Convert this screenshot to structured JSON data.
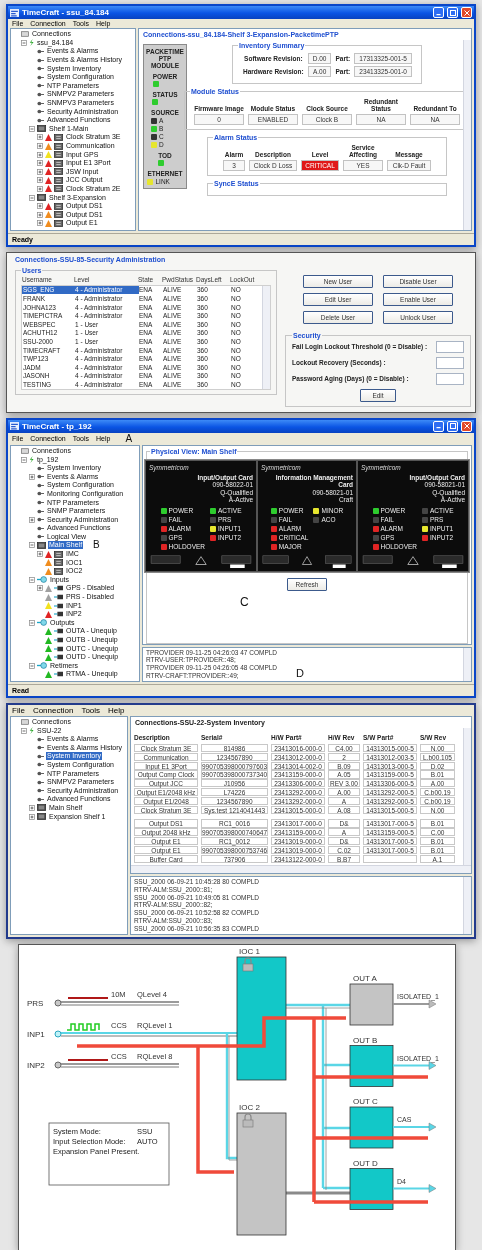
{
  "main_window": {
    "title": "TimeCraft - ssu_84.184",
    "menu": [
      "File",
      "Connection",
      "Tools",
      "Help"
    ],
    "tree": [
      {
        "label": "Connections",
        "kind": "root",
        "selected": false,
        "children": [
          {
            "label": "ssu_84.184",
            "kind": "connection",
            "selected": false,
            "expanded": true,
            "children": [
              {
                "label": "Events & Alarms",
                "kind": "function",
                "selected": false
              },
              {
                "label": "Events & Alarms History",
                "kind": "function",
                "selected": false
              },
              {
                "label": "System Inventory",
                "kind": "function",
                "selected": false
              },
              {
                "label": "System Configuration",
                "kind": "function",
                "selected": false
              },
              {
                "label": "NTP Parameters",
                "kind": "function",
                "selected": false
              },
              {
                "label": "SNMPV2 Parameters",
                "kind": "function",
                "selected": false
              },
              {
                "label": "SNMPV3 Parameters",
                "kind": "function",
                "selected": false
              },
              {
                "label": "Security Administration",
                "kind": "function",
                "selected": false
              },
              {
                "label": "Advanced Functions",
                "kind": "function",
                "selected": false
              },
              {
                "label": "Shelf 1-Main",
                "kind": "shelf",
                "selected": false,
                "expanded": true,
                "children": [
                  {
                    "label": "Clock Stratum 3E",
                    "kind": "card",
                    "color": "#e02424",
                    "selected": false,
                    "expanded": false
                  },
                  {
                    "label": "Communication",
                    "kind": "card",
                    "color": "#f08c1e",
                    "selected": false,
                    "expanded": false
                  },
                  {
                    "label": "Input GPS",
                    "kind": "card",
                    "color": "#f2e21e",
                    "selected": false,
                    "expanded": false
                  },
                  {
                    "label": "Input E1 3Port",
                    "kind": "card",
                    "color": "#e02424",
                    "selected": false,
                    "expanded": false
                  },
                  {
                    "label": "JSW Input",
                    "kind": "card",
                    "color": "#e02424",
                    "selected": false,
                    "expanded": false
                  },
                  {
                    "label": "JCC Output",
                    "kind": "card",
                    "color": "#e02424",
                    "selected": false,
                    "expanded": false
                  },
                  {
                    "label": "Clock Stratum 2E",
                    "kind": "card",
                    "color": "#e02424",
                    "selected": false,
                    "expanded": false
                  }
                ]
              },
              {
                "label": "Shelf 3-Expansion",
                "kind": "shelf",
                "selected": false,
                "expanded": true,
                "children": [
                  {
                    "label": "Output DS1",
                    "kind": "card",
                    "color": "#e02424",
                    "selected": false,
                    "expanded": false
                  },
                  {
                    "label": "Output DS1",
                    "kind": "card",
                    "color": "#f08c1e",
                    "selected": false,
                    "expanded": false
                  },
                  {
                    "label": "Output E1",
                    "kind": "card",
                    "color": "#f08c1e",
                    "selected": false,
                    "expanded": false
                  }
                ]
              }
            ]
          }
        ]
      }
    ],
    "status": "Ready",
    "content": {
      "title": "Connections-ssu_84.184-Shelf 3-Expansion-PacketimePTP",
      "module": {
        "name": "PACKETIME PTP MODULE",
        "groups": [
          {
            "title": "POWER",
            "leds": [
              {
                "color": "#2ecc2e"
              }
            ]
          },
          {
            "title": "STATUS",
            "leds": [
              {
                "color": "#2ecc2e"
              }
            ]
          },
          {
            "title": "SOURCE",
            "leds": [
              {
                "label": "A",
                "color": "#333333"
              },
              {
                "label": "B",
                "color": "#2ecc2e"
              },
              {
                "label": "C",
                "color": "#333333"
              },
              {
                "label": "D",
                "color": "#e6e62e"
              }
            ]
          },
          {
            "title": "TOD",
            "leds": [
              {
                "color": "#2ecc2e"
              }
            ]
          },
          {
            "title": "ETHERNET",
            "leds": [
              {
                "label": "LINK",
                "color": "#e6e62e"
              }
            ]
          }
        ]
      },
      "inventory": {
        "title": "Inventory Summary",
        "rows": [
          {
            "label": "Software Revision:",
            "value": "D.00",
            "part_label": "Part:",
            "part": "17313325-001-5"
          },
          {
            "label": "Hardware Revision:",
            "value": "A.00",
            "part_label": "Part:",
            "part": "23413325-001-0"
          }
        ]
      },
      "module_status": {
        "title": "Module Status",
        "fields": [
          {
            "label": "Firmware Image",
            "value": "0",
            "kind": "plain"
          },
          {
            "label": "Module Status",
            "value": "ENABLED",
            "kind": "plain"
          },
          {
            "label": "Clock Source",
            "value": "Clock B",
            "kind": "plain"
          },
          {
            "label": "Redundant Status",
            "value": "NA",
            "kind": "plain"
          },
          {
            "label": "Redundant To",
            "value": "NA",
            "kind": "plain"
          }
        ]
      },
      "alarm_status": {
        "title": "Alarm Status",
        "fields": [
          {
            "label": "Alarm",
            "value": "3",
            "kind": "plain"
          },
          {
            "label": "Description",
            "value": "Clock D Loss",
            "kind": "plain"
          },
          {
            "label": "Level",
            "value": "CRITICAL",
            "kind": "critical"
          },
          {
            "label": "Service Affecting",
            "value": "YES",
            "kind": "plain"
          },
          {
            "label": "Message",
            "value": "Clk-D Fault",
            "kind": "plain"
          }
        ]
      },
      "synce_title": "SyncE Status"
    }
  },
  "security_window": {
    "title": "Connections-SSU-85-Security Administration",
    "users": {
      "title": "Users",
      "columns": [
        "Username",
        "Level",
        "State",
        "PwdStatus",
        "DaysLeft",
        "LockOut"
      ],
      "rows": [
        {
          "cells": [
            "SGS_ENG",
            "4 - Administrator",
            "ENA",
            "ALIVE",
            "360",
            "NO"
          ],
          "selected": true
        },
        {
          "cells": [
            "FRANK",
            "4 - Administrator",
            "ENA",
            "ALIVE",
            "360",
            "NO"
          ],
          "selected": false
        },
        {
          "cells": [
            "JOHNA123",
            "4 - Administrator",
            "ENA",
            "ALIVE",
            "360",
            "NO"
          ],
          "selected": false
        },
        {
          "cells": [
            "TIMEPICTRA",
            "4 - Administrator",
            "ENA",
            "ALIVE",
            "360",
            "NO"
          ],
          "selected": false
        },
        {
          "cells": [
            "WEBSPEC",
            "1 - User",
            "ENA",
            "ALIVE",
            "360",
            "NO"
          ],
          "selected": false
        },
        {
          "cells": [
            "ACHUTH12",
            "1 - User",
            "ENA",
            "ALIVE",
            "360",
            "NO"
          ],
          "selected": false
        },
        {
          "cells": [
            "SSU-2000",
            "1 - User",
            "ENA",
            "ALIVE",
            "360",
            "NO"
          ],
          "selected": false
        },
        {
          "cells": [
            "TIMECRAFT",
            "4 - Administrator",
            "ENA",
            "ALIVE",
            "360",
            "NO"
          ],
          "selected": false
        },
        {
          "cells": [
            "TWP123",
            "4 - Administrator",
            "ENA",
            "ALIVE",
            "360",
            "NO"
          ],
          "selected": false
        },
        {
          "cells": [
            "JADM",
            "4 - Administrator",
            "ENA",
            "ALIVE",
            "360",
            "NO"
          ],
          "selected": false
        },
        {
          "cells": [
            "JASONH",
            "4 - Administrator",
            "ENA",
            "ALIVE",
            "360",
            "NO"
          ],
          "selected": false
        },
        {
          "cells": [
            "TESTING",
            "4 - Administrator",
            "ENA",
            "ALIVE",
            "360",
            "NO"
          ],
          "selected": false
        }
      ]
    },
    "buttons": [
      "New User",
      "Disable User",
      "Edit User",
      "Enable User",
      "Delete User",
      "Unlock User"
    ],
    "security": {
      "title": "Security",
      "fields": [
        "Fail Login Lockout Threshold (0 = Disable) :",
        "Lockout Recovery (Seconds) :",
        "Password Aging (Days) (0 = Disable) :"
      ],
      "button": "Edit"
    }
  },
  "physical_window": {
    "title": "TimeCraft - tp_192",
    "menu": [
      "File",
      "Connection",
      "Tools",
      "Help"
    ],
    "menu_note": "A",
    "tree": [
      {
        "label": "Connections",
        "kind": "root",
        "selected": false,
        "children": [
          {
            "label": "tp_192",
            "kind": "connection",
            "selected": false,
            "expanded": true,
            "children": [
              {
                "label": "System Inventory",
                "kind": "function",
                "selected": false
              },
              {
                "label": "Events & Alarms",
                "kind": "function",
                "selected": false,
                "expanded": false
              },
              {
                "label": "System Configuration",
                "kind": "function",
                "selected": false
              },
              {
                "label": "Monitoring Configuration",
                "kind": "function",
                "selected": false
              },
              {
                "label": "NTP Parameters",
                "kind": "function",
                "selected": false
              },
              {
                "label": "SNMP Parameters",
                "kind": "function",
                "selected": false
              },
              {
                "label": "Security Administration",
                "kind": "function",
                "selected": false,
                "expanded": false
              },
              {
                "label": "Advanced Functions",
                "kind": "function",
                "selected": false
              },
              {
                "label": "Logical View",
                "kind": "function",
                "selected": false
              },
              {
                "label": "Main Shelf",
                "kind": "shelf",
                "selected": true,
                "expanded": true,
                "note": "B",
                "children": [
                  {
                    "label": "IMC",
                    "kind": "card",
                    "color": "#e02424",
                    "selected": false,
                    "expanded": false
                  },
                  {
                    "label": "IOC1",
                    "kind": "card",
                    "color": "#f08c1e",
                    "selected": false
                  },
                  {
                    "label": "IOC2",
                    "kind": "card",
                    "color": "#f08c1e",
                    "selected": false
                  }
                ]
              },
              {
                "label": "Inputs",
                "kind": "group",
                "selected": false,
                "expanded": true,
                "children": [
                  {
                    "label": "GPS - Disabled",
                    "kind": "port",
                    "color": "#a0a0a0",
                    "selected": false,
                    "expanded": false
                  },
                  {
                    "label": "PRS - Disabled",
                    "kind": "port",
                    "color": "#a0a0a0",
                    "selected": false
                  },
                  {
                    "label": "INP1",
                    "kind": "port",
                    "color": "#f2e21e",
                    "selected": false
                  },
                  {
                    "label": "INP2",
                    "kind": "port",
                    "color": "#e02424",
                    "selected": false
                  }
                ]
              },
              {
                "label": "Outputs",
                "kind": "group",
                "selected": false,
                "expanded": true,
                "children": [
                  {
                    "label": "OUTA - Unequip",
                    "kind": "port",
                    "color": "#22b822",
                    "selected": false
                  },
                  {
                    "label": "OUTB - Unequip",
                    "kind": "port",
                    "color": "#22b822",
                    "selected": false
                  },
                  {
                    "label": "OUTC - Unequip",
                    "kind": "port",
                    "color": "#22b822",
                    "selected": false
                  },
                  {
                    "label": "OUTD - Unequip",
                    "kind": "port",
                    "color": "#22b822",
                    "selected": false
                  }
                ]
              },
              {
                "label": "Retimers",
                "kind": "group",
                "selected": false,
                "expanded": true,
                "children": [
                  {
                    "label": "RTMA - Unequip",
                    "kind": "port",
                    "color": "#22b822",
                    "selected": false
                  }
                ]
              }
            ]
          }
        ]
      }
    ],
    "status": "Read",
    "view": {
      "title": "Physical View: Main Shelf",
      "note": "C",
      "refresh": "Refresh",
      "cards": [
        {
          "brand": "Symmetricom",
          "title": "Input/Output Card",
          "part": "090-58022-01",
          "notes": [
            "Q-Qualified",
            "A-Active"
          ],
          "leds": [
            {
              "label": "POWER",
              "color": "#2ecc2e"
            },
            {
              "label": "FAIL",
              "color": "#444444"
            },
            {
              "label": "ALARM",
              "color": "#e02424"
            },
            {
              "label": "GPS",
              "color": "#444444"
            },
            {
              "label": "HOLDOVER",
              "color": "#e02424"
            },
            {
              "label": "ACTIVE",
              "color": "#2ecc2e"
            },
            {
              "label": "PRS",
              "color": "#444444"
            },
            {
              "label": "INPUT1",
              "color": "#e6e62e"
            },
            {
              "label": "INPUT2",
              "color": "#e02424"
            }
          ]
        },
        {
          "brand": "Symmetricom",
          "title": "Information Management Card",
          "part": "090-58021-01",
          "notes": [
            "Craft"
          ],
          "leds": [
            {
              "label": "POWER",
              "color": "#2ecc2e"
            },
            {
              "label": "FAIL",
              "color": "#444444"
            },
            {
              "label": "ALARM",
              "color": "#e02424"
            },
            {
              "label": "CRITICAL",
              "color": "#e02424"
            },
            {
              "label": "MAJOR",
              "color": "#e02424"
            },
            {
              "label": "MINOR",
              "color": "#e6e62e"
            },
            {
              "label": "ACO",
              "color": "#444444"
            }
          ]
        },
        {
          "brand": "Symmetricom",
          "title": "Input/Output Card",
          "part": "090-58021-01",
          "notes": [
            "Q-Qualified",
            "A-Active"
          ],
          "leds": [
            {
              "label": "POWER",
              "color": "#2ecc2e"
            },
            {
              "label": "FAIL",
              "color": "#444444"
            },
            {
              "label": "ALARM",
              "color": "#e02424"
            },
            {
              "label": "GPS",
              "color": "#444444"
            },
            {
              "label": "HOLDOVER",
              "color": "#e02424"
            },
            {
              "label": "ACTIVE",
              "color": "#444444"
            },
            {
              "label": "PRS",
              "color": "#444444"
            },
            {
              "label": "INPUT1",
              "color": "#e6e62e"
            },
            {
              "label": "INPUT2",
              "color": "#e02424"
            }
          ]
        }
      ]
    },
    "log": [
      "TPROVIDER 09-11-25 04:26:03 47 COMPLD",
      "RTRV-USER:TPROVIDER::48;",
      "TPROVIDER 09-11-25 04:26:05 48 COMPLD",
      "RTRV-CRAFT:TPROVIDER::49;"
    ],
    "log_note": "D"
  },
  "inventory_window": {
    "menu": [
      "File",
      "Connection",
      "Tools",
      "Help"
    ],
    "tree": [
      {
        "label": "Connections",
        "kind": "root",
        "selected": false,
        "children": [
          {
            "label": "SSU-22",
            "kind": "connection",
            "selected": false,
            "expanded": true,
            "children": [
              {
                "label": "Events & Alarms",
                "kind": "function",
                "selected": false
              },
              {
                "label": "Events & Alarms History",
                "kind": "function",
                "selected": false
              },
              {
                "label": "System Inventory",
                "kind": "function",
                "selected": true
              },
              {
                "label": "System Configuration",
                "kind": "function",
                "selected": false
              },
              {
                "label": "NTP Parameters",
                "kind": "function",
                "selected": false
              },
              {
                "label": "SNMPV2 Parameters",
                "kind": "function",
                "selected": false
              },
              {
                "label": "Security Administration",
                "kind": "function",
                "selected": false
              },
              {
                "label": "Advanced Functions",
                "kind": "function",
                "selected": false
              },
              {
                "label": "Main Shelf",
                "kind": "shelf",
                "selected": false,
                "expanded": false
              },
              {
                "label": "Expansion Shelf 1",
                "kind": "shelf",
                "selected": false,
                "expanded": false
              }
            ]
          }
        ]
      }
    ],
    "title": "Connections-SSU-22-System Inventory",
    "columns": [
      "Description",
      "Serial#",
      "H/W Part#",
      "H/W Rev",
      "S/W Part#",
      "S/W Rev"
    ],
    "groups": [
      [
        {
          "description": "Clock Stratum 3E",
          "serial": "814986",
          "hw_part": "23413016-000-0",
          "hw_rev": "C4.00",
          "sw_part": "14313015-000-5",
          "sw_rev": "N.00"
        },
        {
          "description": "Communication",
          "serial": "1234567890",
          "hw_part": "23413012-000-0",
          "hw_rev": "2",
          "sw_part": "14313012-003-5",
          "sw_rev": "L.b00.105"
        },
        {
          "description": "Input E1 3Port",
          "serial": "990705398000797603",
          "hw_part": "23413014-002-0",
          "hw_rev": "B.09",
          "sw_part": "14313013-000-5",
          "sw_rev": "D.02"
        },
        {
          "description": "Output Comp Clock",
          "serial": "990705398000737340",
          "hw_part": "23413159-000-0",
          "hw_rev": "A.05",
          "sw_part": "14313159-000-5",
          "sw_rev": "B.01"
        },
        {
          "description": "Output JCC",
          "serial": "J10956",
          "hw_part": "23413306-000-0",
          "hw_rev": "REV 3.00",
          "sw_part": "14313306-000-5",
          "sw_rev": "A.00"
        },
        {
          "description": "Output E1/2048 kHz",
          "serial": "L74226",
          "hw_part": "23413292-000-0",
          "hw_rev": "A.00",
          "sw_part": "14313292-000-5",
          "sw_rev": "C.b00.19"
        },
        {
          "description": "Output E1/2048",
          "serial": "1234567890",
          "hw_part": "23413292-000-0",
          "hw_rev": "A",
          "sw_part": "14313292-000-5",
          "sw_rev": "C.b00.19"
        },
        {
          "description": "Clock Stratum 3E",
          "serial": "Sys.test 1214041443",
          "hw_part": "23413015-000-0",
          "hw_rev": "A.08",
          "sw_part": "14313015-000-5",
          "sw_rev": "N.00"
        }
      ],
      [
        {
          "description": "Output DS1",
          "serial": "RC1_0016",
          "hw_part": "23413017-000-0",
          "hw_rev": "D&",
          "sw_part": "14313017-000-5",
          "sw_rev": "B.01"
        },
        {
          "description": "Output 2048 kHz",
          "serial": "990705398000740647",
          "hw_part": "23413159-000-0",
          "hw_rev": "A",
          "sw_part": "14313159-000-5",
          "sw_rev": "C.00"
        },
        {
          "description": "Output E1",
          "serial": "RC1_0012",
          "hw_part": "23413019-000-0",
          "hw_rev": "D&",
          "sw_part": "14313017-000-5",
          "sw_rev": "B.01"
        },
        {
          "description": "Output E1",
          "serial": "990705398000753746",
          "hw_part": "23413019-000-0",
          "hw_rev": "C.02",
          "sw_part": "14313017-000-5",
          "sw_rev": "B.01"
        },
        {
          "description": "Buffer Card",
          "serial": "737906",
          "hw_part": "23413122-000-0",
          "hw_rev": "B.B7",
          "sw_rev": "A.1"
        }
      ]
    ],
    "log": [
      "SSU_2000 06-09-21 10:45:28 80 COMPLD",
      "RTRV-ALM:SSU_2000::81;",
      "SSU_2000 06-09-21 10:49:05 81 COMPLD",
      "RTRV-ALM:SSU_2000::82;",
      "SSU_2000 06-09-21 10:52:58 82 COMPLD",
      "RTRV-ALM:SSU_2000::83;",
      "SSU_2000 06-09-21 10:56:35 83 COMPLD"
    ]
  },
  "diagram": {
    "cards": [
      {
        "label": "IOC 1",
        "active": true
      },
      {
        "label": "IOC 2",
        "active": false
      }
    ],
    "inputs": [
      {
        "label": "PRS",
        "signal": "10M",
        "quality": "QLevel 4",
        "active": false
      },
      {
        "label": "INP1",
        "signal": "CCS",
        "quality": "RQLevel 1",
        "active": true
      },
      {
        "label": "INP2",
        "signal": "CCS",
        "quality": "RQLevel 8",
        "active": false
      }
    ],
    "outputs": [
      {
        "label": "OUT A",
        "format": "ISOLATED_1",
        "active": false
      },
      {
        "label": "OUT B",
        "format": "ISOLATED_1",
        "active": true
      },
      {
        "label": "OUT C",
        "format": "CAS",
        "active": true
      },
      {
        "label": "OUT D",
        "format": "D4",
        "active": true
      }
    ],
    "info": [
      {
        "label": "System Mode:",
        "value": "SSU"
      },
      {
        "label": "Input Selection Mode:",
        "value": "AUTO"
      },
      {
        "label": "Expansion Panel Present."
      }
    ]
  }
}
